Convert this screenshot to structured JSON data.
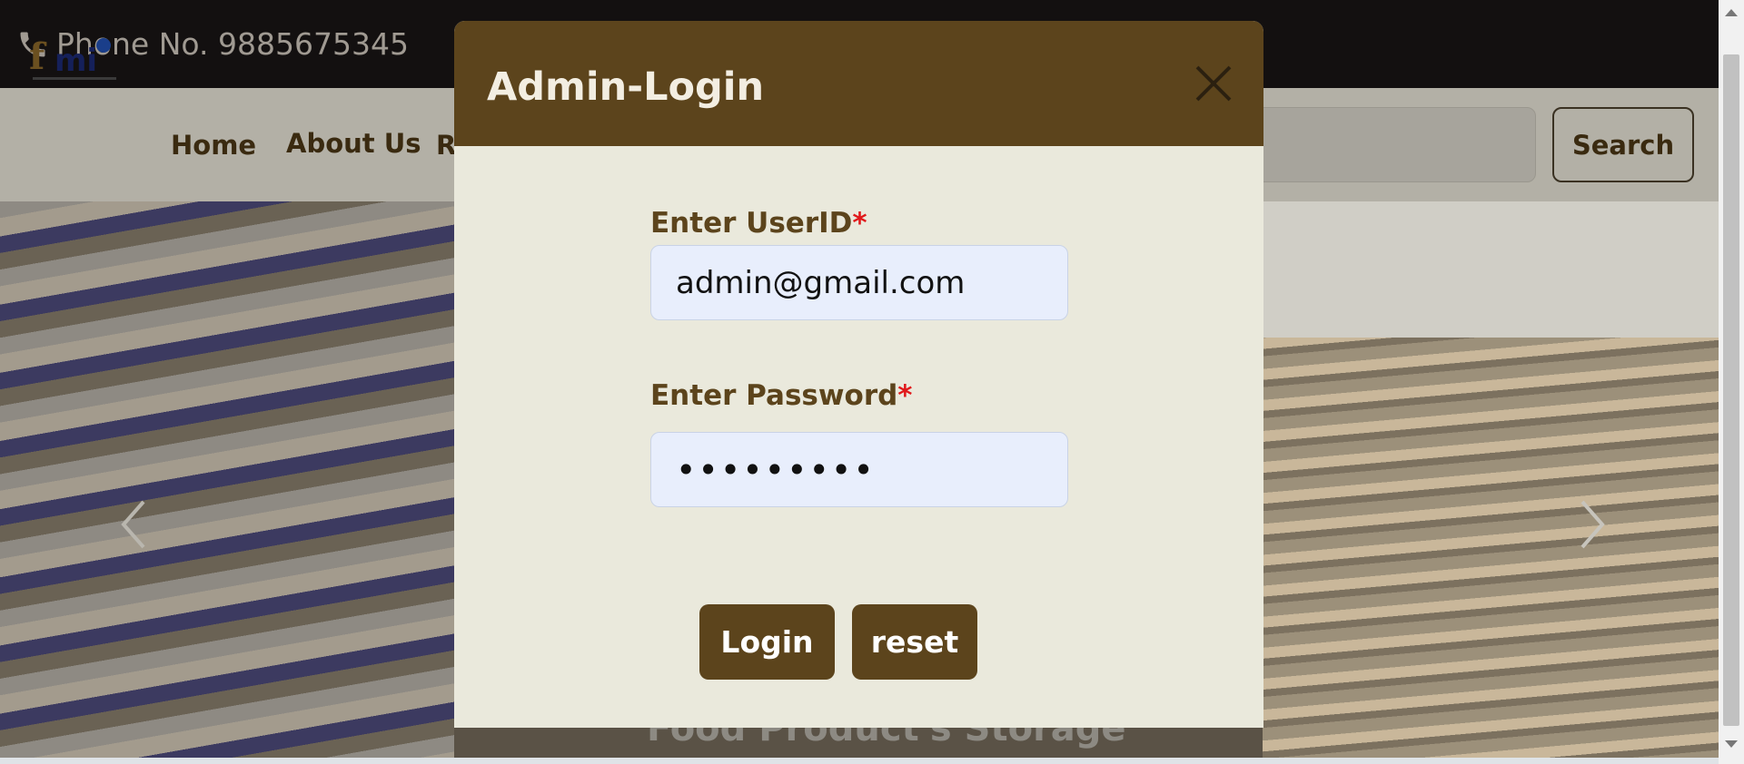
{
  "topbar": {
    "phone_text": "Phone No. 9885675345",
    "icon": "phone-icon"
  },
  "navbar": {
    "logo_text": "fmi",
    "items": [
      {
        "label": "Home"
      },
      {
        "label": "About Us"
      },
      {
        "label": "R"
      }
    ],
    "search_button": "Search"
  },
  "hero": {
    "caption": "Food Product's Storage"
  },
  "modal": {
    "title": "Admin-Login",
    "userid_label": "Enter UserID",
    "userid_value": "admin@gmail.com",
    "password_label": "Enter Password",
    "password_value": "•••••••••",
    "required_mark": "*",
    "login_button": "Login",
    "reset_button": "reset"
  },
  "colors": {
    "header_brown": "#5c441c",
    "modal_bg": "#eae9dc",
    "input_bg": "#e8eefc",
    "required_red": "#e0191b"
  }
}
